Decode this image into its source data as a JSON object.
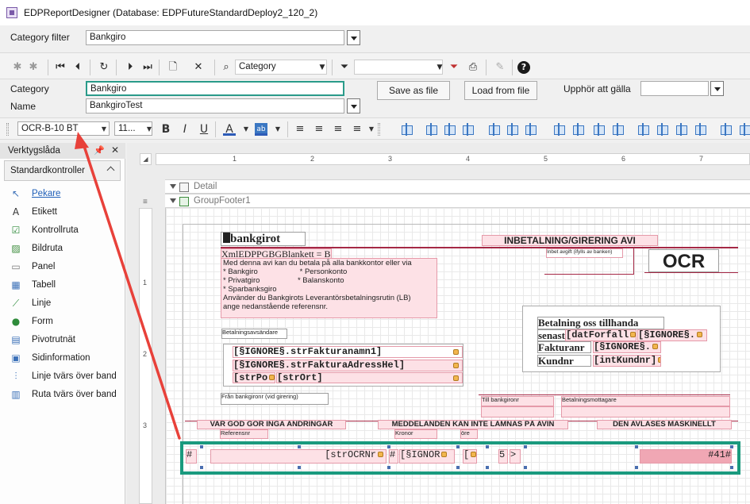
{
  "window": {
    "title": "EDPReportDesigner (Database: EDPFutureStandardDeploy2_120_2)"
  },
  "filter": {
    "label": "Category filter",
    "value": "Bankgiro"
  },
  "toolbar": {
    "search_icon": "magnifier-icon",
    "search_field_value": "Category",
    "filter_field_value": ""
  },
  "props": {
    "category_label": "Category",
    "category_value": "Bankgiro",
    "name_label": "Name",
    "name_value": "BankgiroTest",
    "save_button": "Save as file",
    "load_button": "Load from file",
    "expire_label": "Upphör att gälla",
    "expire_value": ""
  },
  "format": {
    "font_name": "OCR-B-10 BT",
    "font_size": "11...",
    "bold": "B",
    "italic": "I",
    "underline": "U",
    "fore_color": "A"
  },
  "toolbox": {
    "title": "Verktygslåda",
    "group": "Standardkontroller",
    "items": [
      {
        "label": "Pekare",
        "icon": "pointer-icon"
      },
      {
        "label": "Etikett",
        "icon": "label-icon"
      },
      {
        "label": "Kontrollruta",
        "icon": "checkbox-icon"
      },
      {
        "label": "Bildruta",
        "icon": "picture-icon"
      },
      {
        "label": "Panel",
        "icon": "panel-icon"
      },
      {
        "label": "Tabell",
        "icon": "table-icon"
      },
      {
        "label": "Linje",
        "icon": "line-icon"
      },
      {
        "label": "Form",
        "icon": "shape-icon"
      },
      {
        "label": "Pivotrutnät",
        "icon": "pivot-grid-icon"
      },
      {
        "label": "Sidinformation",
        "icon": "page-info-icon"
      },
      {
        "label": "Linje tvärs över band",
        "icon": "cross-band-line-icon"
      },
      {
        "label": "Ruta tvärs över band",
        "icon": "cross-band-box-icon"
      }
    ]
  },
  "ruler": {
    "h_numbers": [
      "1",
      "2",
      "3",
      "4",
      "5",
      "6",
      "7"
    ],
    "v_numbers": [
      "1",
      "2",
      "3"
    ]
  },
  "bands": {
    "detail": "Detail",
    "group_footer": "GroupFooter1"
  },
  "report": {
    "logo": "bankgirot",
    "heading": "INBETALNING/GIRERING   AVI",
    "ocr": "OCR",
    "inbet_note": "Inbet avgift (ifylls av banken)",
    "xml_field": "XmlEDPPGBGBlankett = BG",
    "info_lines": [
      "Med denna avi kan du betala på alla bankkontor eller via",
      "* Bankgiro                    * Personkonto",
      "* Privatgiro                  * Balanskonto",
      "* Sparbanksgiro",
      "Använder du Bankgirots Leverantörsbetalningsrutin (LB)",
      "ange nedanstående referensnr."
    ],
    "sender_label": "Betalningsavsändare",
    "sender_name": "[§IGNORE§.strFakturanamn1]",
    "sender_address": "[§IGNORE§.strFakturaAdressHel]",
    "sender_zip": "[strPo",
    "sender_city": "[strOrt]",
    "pay_title": "Betalning oss tillhanda",
    "pay_rows": [
      {
        "label": "senast",
        "value": "[datForfall",
        "extra": "[§IGNORE§."
      },
      {
        "label": "Fakturanr",
        "value": "[§IGNORE§."
      },
      {
        "label": "Kundnr",
        "value": "[intKundnr]"
      }
    ],
    "from_bg": "Från bankgironr (vid girering)",
    "to_bg": "Till bankgironr",
    "receiver": "Betalningsmottagare",
    "warn_left": "VAR GOD GÖR INGA ÄNDRINGAR",
    "warn_mid": "MEDDELANDEN KAN INTE LÄMNAS PÅ AVIN",
    "warn_right": "DEN AVLÄSES MASKINELLT",
    "ref_label": "Referensnr",
    "kronor_label": "Kronor",
    "ore_label": "öre",
    "ocr_hash": "#",
    "ocr_field": "[strOCRNr",
    "ocr_hash2": "#",
    "ocr_ignore": "[§IGNOR",
    "ocr_bracket": "[",
    "ocr_five": "5",
    "ocr_gt": ">",
    "ocr_tail": "#41#"
  },
  "colors": {
    "selection": "#1a9a7e",
    "annotation_arrow": "#e8413a",
    "band_line": "#a52845",
    "control_fill": "#fde1e6"
  }
}
